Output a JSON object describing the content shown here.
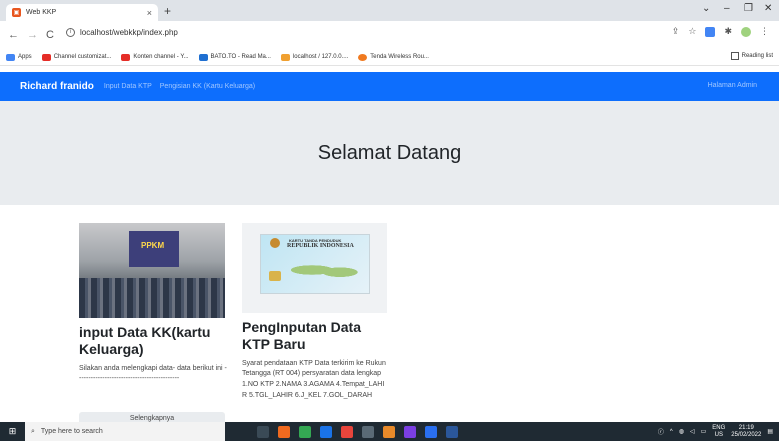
{
  "browser": {
    "tab_title": "Web KKP",
    "tab_close": "×",
    "new_tab": "+",
    "address": "localhost/webkkp/index.php",
    "win_minimize": "–",
    "win_maximize": "❐",
    "win_close": "✕",
    "bookmarks": [
      {
        "label": "Apps",
        "color": "#4285f4"
      },
      {
        "label": "Channel customizat...",
        "color": "#e52d27"
      },
      {
        "label": "Konten channel - Y...",
        "color": "#e52d27"
      },
      {
        "label": "BATO.TO - Read Ma...",
        "color": "#1f6fd1"
      },
      {
        "label": "localhost / 127.0.0....",
        "color": "#f0a030"
      },
      {
        "label": "Tenda Wireless Rou...",
        "color": "#f07a20"
      }
    ],
    "reading_list": "Reading list"
  },
  "navbar": {
    "brand": "Richard franido",
    "links": [
      "Input Data KTP",
      "Pengisian KK (Kartu Keluarga)"
    ],
    "right_link": "Halaman Admin"
  },
  "hero": {
    "title": "Selamat Datang"
  },
  "cards": [
    {
      "title": "input Data KK(kartu Keluarga)",
      "text": "Silakan anda melengkapi data- data berikut ini --------------------------------------------",
      "button": "Selengkapnya",
      "image_banner": "PPKM"
    },
    {
      "title": "PengInputan Data KTP Baru",
      "text": "Syarat pendataan KTP Data terkirim ke Rukun Tetangga (RT 004) persyaratan data lengkap 1.NO KTP 2.NAMA 3.AGAMA 4.Tempat_LAHIR 5.TGL_LAHIR 6.J_KEL 7.GOL_DARAH",
      "image_card_line1": "KARTU TANDA PENDUDUK",
      "image_card_line2": "REPUBLIK INDONESIA"
    }
  ],
  "taskbar": {
    "search_placeholder": "Type here to search",
    "lang": "ENG",
    "lang_sub": "US",
    "time": "21:19",
    "date": "25/02/2022",
    "app_colors": [
      "#3a4a56",
      "#f06a1f",
      "#34a853",
      "#1a73e8",
      "#e8453c",
      "#5a6a76",
      "#e88a2a",
      "#7b3fe4",
      "#2a6ff0",
      "#2b579a"
    ]
  }
}
